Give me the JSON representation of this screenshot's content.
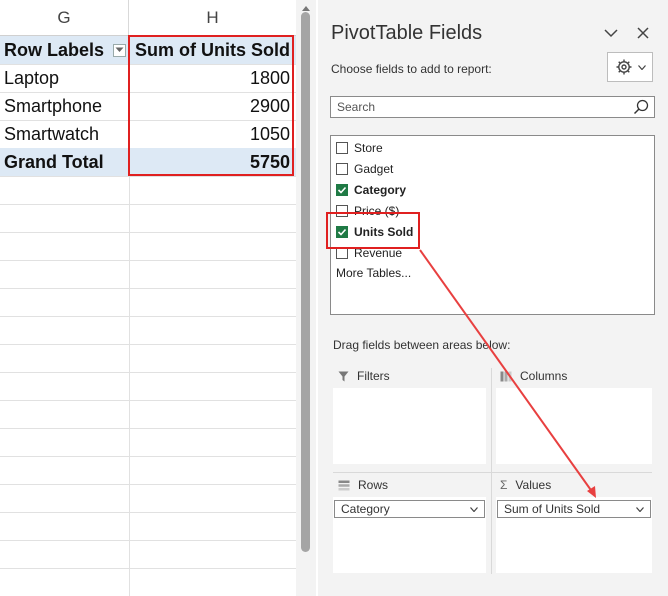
{
  "sheet": {
    "columns": [
      "G",
      "H"
    ],
    "header": {
      "row_labels": "Row Labels",
      "sum_units": "Sum of Units Sold"
    },
    "rows": [
      {
        "label": "Laptop",
        "value": "1800"
      },
      {
        "label": "Smartphone",
        "value": "2900"
      },
      {
        "label": "Smartwatch",
        "value": "1050"
      }
    ],
    "total": {
      "label": "Grand Total",
      "value": "5750"
    }
  },
  "panel": {
    "title": "PivotTable Fields",
    "choose_label": "Choose fields to add to report:",
    "search_placeholder": "Search",
    "fields": [
      {
        "label": "Store",
        "checked": false
      },
      {
        "label": "Gadget",
        "checked": false
      },
      {
        "label": "Category",
        "checked": true
      },
      {
        "label": "Price ($)",
        "checked": false
      },
      {
        "label": "Units Sold",
        "checked": true
      },
      {
        "label": "Revenue",
        "checked": false
      }
    ],
    "more_tables": "More Tables...",
    "drag_label": "Drag fields between areas below:",
    "areas": {
      "filters": "Filters",
      "columns": "Columns",
      "rows": "Rows",
      "values": "Values"
    },
    "rows_field": "Category",
    "values_field": "Sum of Units Sold"
  },
  "colors": {
    "highlight": "#e02020",
    "pivot_header_bg": "#dde9f5",
    "checkbox_green": "#1f7a45",
    "panel_bg": "#f3f3f3"
  }
}
